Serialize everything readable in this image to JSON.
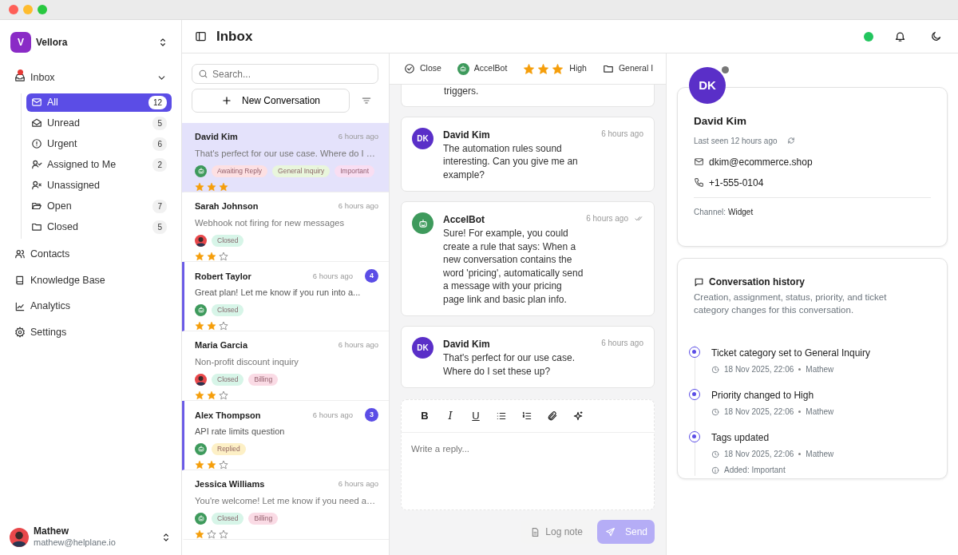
{
  "workspace": {
    "initial": "V",
    "name": "Vellora"
  },
  "nav": [
    {
      "label": "Inbox",
      "alert": true,
      "expanded": true,
      "children": [
        {
          "label": "All",
          "count": "12",
          "selected": true
        },
        {
          "label": "Unread",
          "count": "5",
          "selected": false
        },
        {
          "label": "Urgent",
          "count": "6",
          "selected": false
        },
        {
          "label": "Assigned to Me",
          "count": "2",
          "selected": false
        },
        {
          "label": "Unassigned",
          "selected": false
        },
        {
          "label": "Open",
          "count": "7",
          "selected": false
        },
        {
          "label": "Closed",
          "count": "5",
          "selected": false
        }
      ]
    },
    {
      "label": "Contacts"
    },
    {
      "label": "Knowledge Base"
    },
    {
      "label": "Analytics"
    },
    {
      "label": "Settings"
    }
  ],
  "user": {
    "name": "Mathew",
    "email": "mathew@helplane.io"
  },
  "header": {
    "title": "Inbox",
    "online": true
  },
  "search": {
    "placeholder": "Search..."
  },
  "new_button": "New Conversation",
  "conversations": [
    {
      "name": "David Kim",
      "time": "6 hours ago",
      "preview": "That's perfect for our use case. Where do I …",
      "selected": true,
      "unread": false,
      "avatar": {
        "kind": "bot"
      },
      "stars": 3,
      "tags": [
        {
          "label": "Awaiting Reply",
          "color": "#fde0e3"
        },
        {
          "label": "General Inquiry",
          "color": "#e9f6dc"
        },
        {
          "label": "Important",
          "color": "#f9def2"
        }
      ]
    },
    {
      "name": "Sarah Johnson",
      "time": "6 hours ago",
      "preview": "Webhook not firing for new messages",
      "selected": false,
      "unread": false,
      "avatar": {
        "kind": "person"
      },
      "stars": 2,
      "tags": [
        {
          "label": "Closed",
          "color": "#d7f5e8"
        }
      ]
    },
    {
      "name": "Robert Taylor",
      "time": "6 hours ago",
      "preview": "Great plan! Let me know if you run into a...",
      "selected": false,
      "unread": true,
      "count": "4",
      "avatar": {
        "kind": "bot"
      },
      "stars": 2,
      "tags": [
        {
          "label": "Closed",
          "color": "#d7f5e8"
        }
      ]
    },
    {
      "name": "Maria Garcia",
      "time": "6 hours ago",
      "preview": "Non-profit discount inquiry",
      "selected": false,
      "unread": false,
      "avatar": {
        "kind": "person"
      },
      "stars": 2,
      "tags": [
        {
          "label": "Closed",
          "color": "#d7f5e8"
        },
        {
          "label": "Billing",
          "color": "#fadbe5"
        }
      ]
    },
    {
      "name": "Alex Thompson",
      "time": "6 hours ago",
      "preview": "API rate limits question",
      "selected": false,
      "unread": true,
      "count": "3",
      "avatar": {
        "kind": "bot"
      },
      "stars": 2,
      "tags": [
        {
          "label": "Replied",
          "color": "#fdf0c6"
        }
      ]
    },
    {
      "name": "Jessica Williams",
      "time": "6 hours ago",
      "preview": "You're welcome! Let me know if you need a…",
      "selected": false,
      "unread": false,
      "avatar": {
        "kind": "bot"
      },
      "stars": 1,
      "tags": [
        {
          "label": "Closed",
          "color": "#d7f5e8"
        },
        {
          "label": "Billing",
          "color": "#fadbe5"
        }
      ]
    }
  ],
  "chat_toolbar": [
    {
      "kind": "action",
      "label": "Close"
    },
    {
      "kind": "assignee",
      "label": "AccelBot"
    },
    {
      "kind": "priority",
      "label": "High",
      "stars": 3
    },
    {
      "kind": "category",
      "label": "General I"
    }
  ],
  "partial_message": "triggers.",
  "messages": [
    {
      "kind": "contact",
      "initials": "DK",
      "author": "David Kim",
      "time": "6 hours ago",
      "text": "The automation rules sound interesting. Can you give me an example?",
      "delivered": false
    },
    {
      "kind": "bot",
      "author": "AccelBot",
      "time": "6 hours ago",
      "text": "Sure! For example, you could create a rule that says: When a new conversation contains the word 'pricing', automatically send a message with your pricing page link and basic plan info.",
      "delivered": true
    },
    {
      "kind": "contact",
      "initials": "DK",
      "author": "David Kim",
      "time": "6 hours ago",
      "text": "That's perfect for our use case. Where do I set these up?",
      "delivered": false
    }
  ],
  "composer": {
    "format_buttons": [
      "B",
      "I",
      "U"
    ],
    "placeholder": "Write a reply...",
    "buttons": [
      {
        "kind": "note",
        "label": "Log note",
        "disabled": true
      },
      {
        "kind": "send",
        "label": "Send",
        "disabled": true
      }
    ]
  },
  "contact": {
    "initials": "DK",
    "online": false,
    "name": "David Kim",
    "last_seen": "Last seen 12 hours ago",
    "email": "dkim@ecommerce.shop",
    "phone": "+1-555-0104",
    "channel_label": "Channel:",
    "channel": "Widget"
  },
  "history": {
    "title": "Conversation history",
    "description": "Creation, assignment, status, priority, and ticket category changes for this conversation.",
    "events": [
      {
        "title": "Ticket category set to General Inquiry",
        "date": "18 Nov 2025, 22:06",
        "author": "Mathew"
      },
      {
        "title": "Priority changed to High",
        "date": "18 Nov 2025, 22:06",
        "author": "Mathew"
      },
      {
        "title": "Tags updated",
        "date": "18 Nov 2025, 22:06",
        "author": "Mathew",
        "note": "Added: Important"
      }
    ]
  }
}
